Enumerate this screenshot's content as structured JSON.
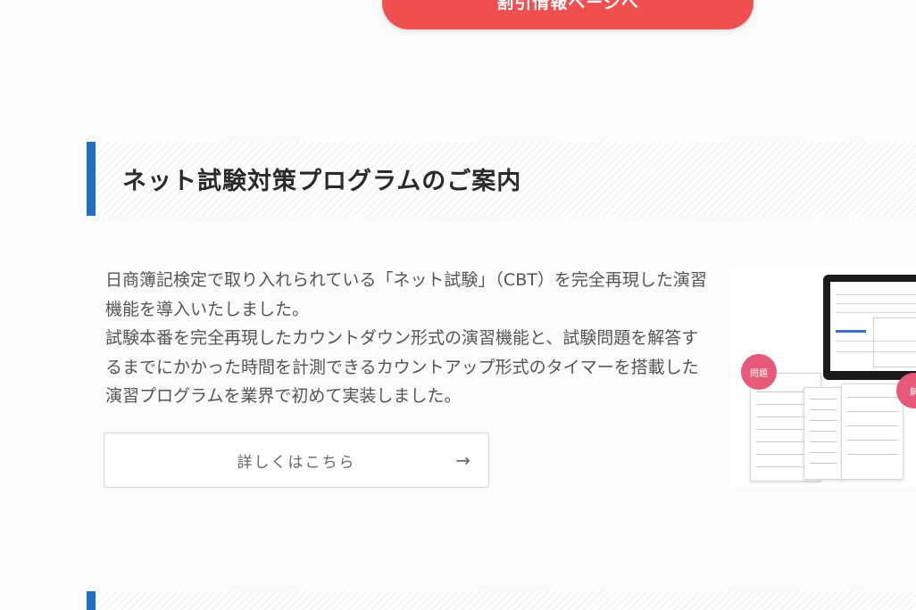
{
  "header": {
    "discount_button_label": "割引情報ページへ"
  },
  "program_section": {
    "title": "ネット試験対策プログラムのご案内",
    "paragraphs": [
      "日商簿記検定で取り入れられている「ネット試験」（CBT）を完全再現した演習機能を導入いたしました。",
      "試験本番を完全再現したカウントダウン形式の演習機能と、試験問題を解答するまでにかかった時間を計測できるカウントアップ形式のタイマーを搭載した演習プログラムを業界で初めて実装しました。"
    ],
    "detail_button_label": "詳しくはこちら",
    "detail_button_arrow": "→",
    "image": {
      "badge_problem": "問題",
      "badge_answer": "解",
      "accent_color": "#e85979"
    }
  },
  "colors": {
    "accent_blue": "#1f6fc4",
    "discount_red": "#ef4f4f"
  }
}
